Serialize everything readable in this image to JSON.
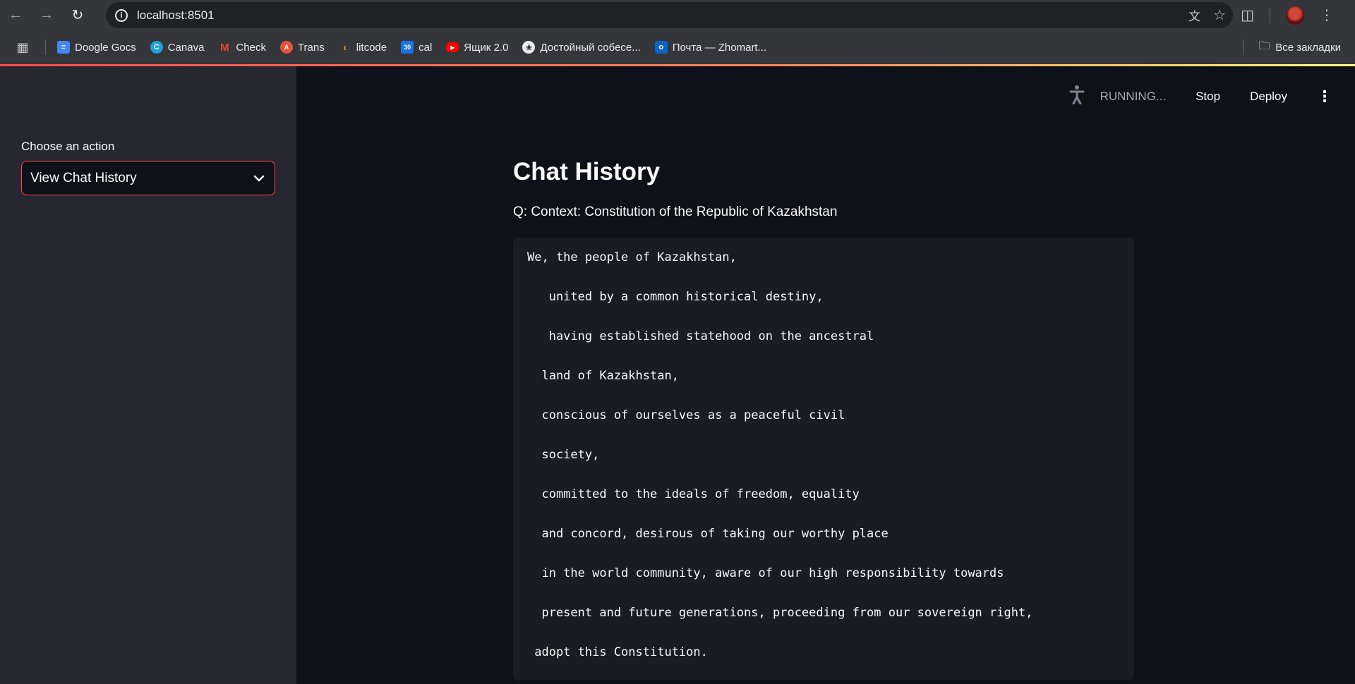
{
  "browser": {
    "url": "localhost:8501",
    "bookmarks": [
      {
        "label": "Doogle Gocs",
        "icon": "docs-icon",
        "color": "#4285f4"
      },
      {
        "label": "Canava",
        "icon": "canva-icon",
        "color": "#1fa0d8"
      },
      {
        "label": "Check",
        "icon": "gmail-icon",
        "color": "#ea4335"
      },
      {
        "label": "Trans",
        "icon": "translate-icon",
        "color": "#e5533c"
      },
      {
        "label": "litcode",
        "icon": "leetcode-icon",
        "color": "#f5a623"
      },
      {
        "label": "cal",
        "icon": "calendar-icon",
        "color": "#1a73e8"
      },
      {
        "label": "Ящик 2.0",
        "icon": "youtube-icon",
        "color": "#ff0000"
      },
      {
        "label": "Достойный собесе...",
        "icon": "openai-icon",
        "color": "#e8eaed"
      },
      {
        "label": "Почта — Zhomart...",
        "icon": "outlook-icon",
        "color": "#0a64c8"
      }
    ],
    "all_bookmarks": "Все закладки"
  },
  "sidebar": {
    "label": "Choose an action",
    "select_value": "View Chat History"
  },
  "header": {
    "status": "RUNNING...",
    "stop": "Stop",
    "deploy": "Deploy"
  },
  "main": {
    "title": "Chat History",
    "question": "Q: Context: Constitution of the Republic of Kazakhstan",
    "code_lines": [
      "We, the people of Kazakhstan,",
      "   united by a common historical destiny,",
      "   having established statehood on the ancestral",
      "  land of Kazakhstan,",
      "  conscious of ourselves as a peaceful civil",
      "  society,",
      "  committed to the ideals of freedom, equality",
      "  and concord, desirous of taking our worthy place",
      "  in the world community, aware of our high responsibility towards",
      "  present and future generations, proceeding from our sovereign right,",
      " adopt this Constitution."
    ]
  },
  "colors": {
    "accent": "#ff4b4b",
    "sidebar_bg": "#262730",
    "main_bg": "#0e1117",
    "code_bg": "#1a1c24"
  }
}
